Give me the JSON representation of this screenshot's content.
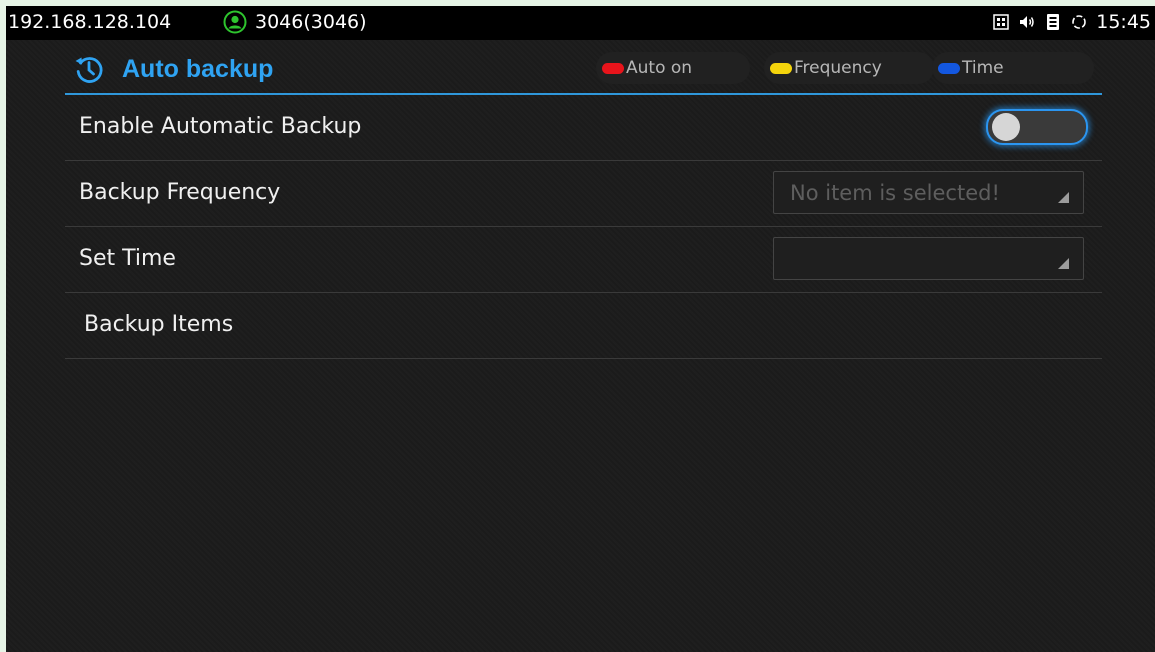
{
  "statusbar": {
    "ip": "192.168.128.104",
    "account": "3046(3046)",
    "time": "15:45",
    "icons": [
      "account-icon",
      "grid-icon",
      "volume-icon",
      "sim-icon",
      "sync-icon"
    ]
  },
  "header": {
    "title": "Auto backup",
    "icon": "history-icon",
    "accent_color": "#2fa3f2"
  },
  "hints": [
    {
      "label": "Auto on",
      "color": "#e8141b"
    },
    {
      "label": "Frequency",
      "color": "#f4d40c"
    },
    {
      "label": "Time",
      "color": "#1357e0"
    }
  ],
  "settings": [
    {
      "label": "Enable Automatic Backup",
      "control": "toggle",
      "value": "off"
    },
    {
      "label": "Backup Frequency",
      "control": "select",
      "value": "No item is selected!"
    },
    {
      "label": "Set Time",
      "control": "select",
      "value": ""
    },
    {
      "label": "Backup Items",
      "control": "none"
    }
  ]
}
